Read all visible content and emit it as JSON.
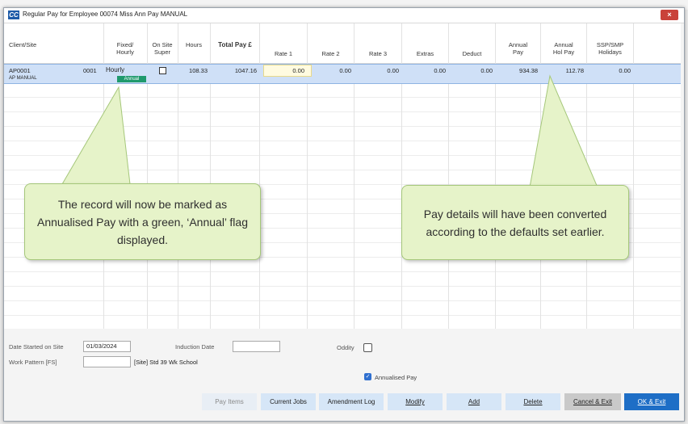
{
  "window": {
    "app_icon": "CC",
    "title": "Regular Pay for Employee 00074 Miss Ann Pay MANUAL",
    "close_icon": "×"
  },
  "columns": {
    "client_site": "Client/Site",
    "fixed_hourly": "Fixed/\nHourly",
    "on_site_super": "On Site\nSuper",
    "hours": "Hours",
    "total_pay": "Total Pay £",
    "rate1": "Rate 1",
    "rate2": "Rate 2",
    "rate3": "Rate 3",
    "extras": "Extras",
    "deduct": "Deduct",
    "annual_pay": "Annual\nPay",
    "annual_hol_pay": "Annual\nHol Pay",
    "ssp_smp": "SSP/SMP\nHolidays"
  },
  "row": {
    "client": "AP0001",
    "site": "0001",
    "client_name": "AP MANUAL",
    "fixed_hourly": "Hourly",
    "annual_flag": "Annual",
    "hours": "108.33",
    "total_pay": "1047.16",
    "rate1": "0.00",
    "rate2": "0.00",
    "rate3": "0.00",
    "extras": "0.00",
    "deduct": "0.00",
    "annual_pay": "934.38",
    "annual_hol_pay": "112.78",
    "ssp_smp": "0.00"
  },
  "callouts": {
    "left": "The record will now be marked as Annualised Pay with a green, ‘Annual’ flag displayed.",
    "right": "Pay details will have been converted according to the defaults set earlier."
  },
  "form": {
    "date_started_label": "Date Started on Site",
    "date_started_value": "01/03/2024",
    "induction_date_label": "Induction Date",
    "induction_date_value": "",
    "oddity_label": "Oddity",
    "work_pattern_label": "Work Pattern [FS]",
    "work_pattern_value": "",
    "work_pattern_desc": "[Site] Std 39 Wk School",
    "annualised_label": "Annualised Pay",
    "annualised_checked": true
  },
  "buttons": {
    "pay_items": "Pay Items",
    "current_jobs": "Current Jobs",
    "amendment_log": "Amendment Log",
    "modify": "Modify",
    "add": "Add",
    "delete": "Delete",
    "cancel_exit": "Cancel & Exit",
    "ok_exit": "OK & Exit"
  },
  "colors": {
    "selection": "#cfe0f7",
    "annual_flag": "#1f9a6d",
    "callout_fill": "#e6f3c9",
    "primary_button": "#1e6ec6"
  }
}
